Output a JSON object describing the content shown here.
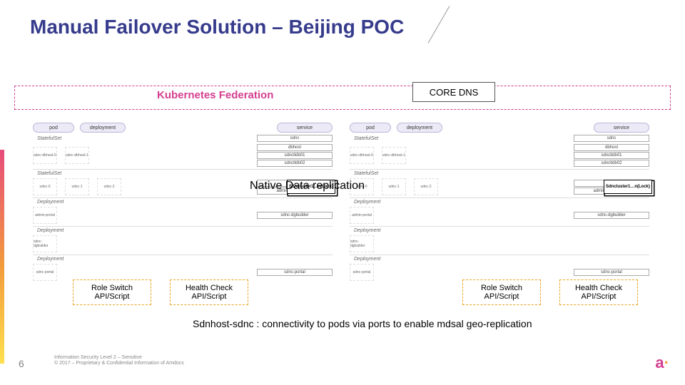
{
  "title": "Manual Failover Solution – Beijing POC",
  "federation_label": "Kubernetes Federation",
  "core_dns": "CORE DNS",
  "native_label": "Native Data replication",
  "pill": {
    "pod": "pod",
    "deployment": "deployment",
    "service": "service",
    "statefulset": "StatefulSet",
    "deployment2": "Deployment"
  },
  "micro": {
    "sdnc": "sdnc",
    "dbhost": "dbhost",
    "sdnctldb01": "sdnctldb01",
    "sdnctldb02": "sdnctldb02",
    "sdnhost": "sdnhost",
    "portal": "sdnc-portal",
    "dgbuilder": "sdnc-dgbuilder",
    "adminportal": "adminportal-cluster"
  },
  "chip": {
    "dbhost0": "sdnc-dbhost-0",
    "dbhost1": "sdnc-dbhost-1",
    "sdnc0": "sdnc-0",
    "sdnc1": "sdnc-1",
    "sdnc2": "sdnc-2",
    "admin": "admin-portal",
    "dg": "sdnc-dgbuilder",
    "port": "sdnc-portal"
  },
  "sdncluster": "Sdncluster1…n(Lock)",
  "api": {
    "role": "Role Switch API/Script",
    "health": "Health Check API/Script"
  },
  "connectivity": "Sdnhost-sdnc : connectivity to pods via ports to enable mdsal geo-replication",
  "page": "6",
  "legal1": "Information Security Level 2 – Sensitive",
  "legal2": "© 2017 – Proprietary & Confidential Information of Amdocs"
}
